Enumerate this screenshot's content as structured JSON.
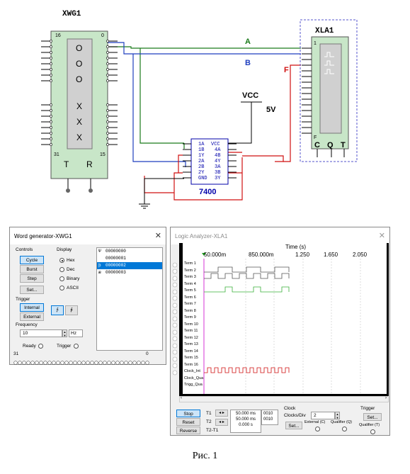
{
  "schematic": {
    "xwg_label": "XWG1",
    "xwg_top_left": "16",
    "xwg_top_right": "0",
    "xwg_bot_left": "31",
    "xwg_bot_right": "15",
    "xwg_t": "T",
    "xwg_r": "R",
    "xwg_o": [
      "O",
      "O",
      "O"
    ],
    "xwg_x": [
      "X",
      "X",
      "X"
    ],
    "xla_label": "XLA1",
    "xla_top": "1",
    "xla_f": "F",
    "xla_c": "C",
    "xla_q": "Q",
    "xla_t": "T",
    "wire_a": "A",
    "wire_b": "B",
    "wire_f": "F",
    "vcc": "VCC",
    "v5": "5V",
    "chip_name": "7400",
    "chip_left": [
      "1A",
      "1B",
      "1Y",
      "2A",
      "2B",
      "2Y",
      "GND"
    ],
    "chip_right": [
      "VCC",
      "4A",
      "4B",
      "4Y",
      "3A",
      "3B",
      "3Y"
    ]
  },
  "word_gen": {
    "title": "Word generator-XWG1",
    "controls_label": "Controls",
    "cycle": "Cycle",
    "burst": "Burst",
    "step": "Step",
    "set": "Set...",
    "display_label": "Display",
    "hex": "Hex",
    "dec": "Dec",
    "binary": "Binary",
    "ascii": "ASCII",
    "trigger_label": "Trigger",
    "internal": "Internal",
    "external": "External",
    "edge_rise": "∱",
    "edge_fall": "∲",
    "frequency_label": "Frequency",
    "freq_value": "10",
    "freq_unit": "Hz",
    "ready": "Ready",
    "trigger_st": "Trigger",
    "bit_left": "31",
    "bit_right": "0",
    "words": [
      {
        "marker": "Ψ",
        "value": "00000000"
      },
      {
        "marker": "",
        "value": "00000001"
      },
      {
        "marker": "þ",
        "value": "00000002"
      },
      {
        "marker": "æ",
        "value": "00000003"
      }
    ]
  },
  "logic": {
    "title": "Logic Analyzer-XLA1",
    "time_label": "Time (s)",
    "ticks": [
      "50.000m",
      "850.000m",
      "1.250",
      "1.650",
      "2.050"
    ],
    "terms": [
      "Term 1",
      "Term 2",
      "Term 3",
      "Term 4",
      "Term 5",
      "Term 6",
      "Term 7",
      "Term 8",
      "Term 9",
      "Term 10",
      "Term 11",
      "Term 12",
      "Term 13",
      "Term 14",
      "Term 15",
      "Term 16",
      "Clock_Int",
      "Clock_Qua",
      "Trigg_Qua"
    ],
    "stop": "Stop",
    "reset": "Reset",
    "reverse": "Reverse",
    "t1": "T1",
    "t2": "T2",
    "t2t1": "T2-T1",
    "t1_val": "50.000 ms",
    "t2_val": "50.000 ms",
    "dt_val": "0.000 s",
    "t1_hex": "0010",
    "t2_hex": "0010",
    "clock_label": "Clock",
    "clocks_div": "Clocks/Div",
    "clocks_val": "2",
    "clock_set": "Set...",
    "external_c": "External (C)",
    "qualifier_q": "Qualifier (Q)",
    "trigger_label": "Trigger",
    "trig_set": "Set...",
    "qualifier_t": "Qualifier (T)"
  },
  "caption": "Рис. 1"
}
